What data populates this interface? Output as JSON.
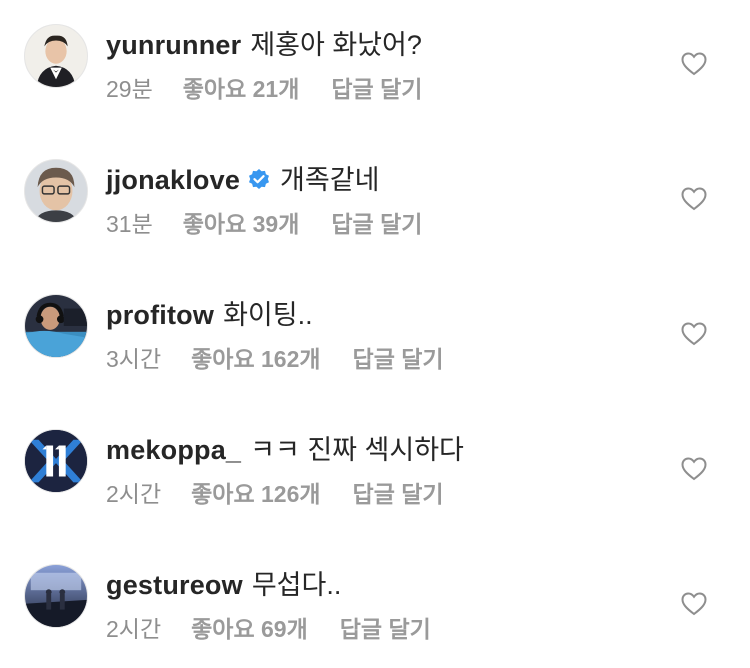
{
  "comments": [
    {
      "username": "yunrunner",
      "verified": false,
      "text": "제홍아 화났어?",
      "time": "29분",
      "likes": "좋아요 21개",
      "reply": "답글 달기",
      "avatar": "avatar-man-suit"
    },
    {
      "username": "jjonaklove",
      "verified": true,
      "text": "개족같네",
      "time": "31분",
      "likes": "좋아요 39개",
      "reply": "답글 달기",
      "avatar": "avatar-man-glasses"
    },
    {
      "username": "profitow",
      "verified": false,
      "text": "화이팅..",
      "time": "3시간",
      "likes": "좋아요 162개",
      "reply": "답글 달기",
      "avatar": "avatar-headset-player"
    },
    {
      "username": "mekoppa_",
      "verified": false,
      "text": "ㅋㅋ 진짜 섹시하다",
      "time": "2시간",
      "likes": "좋아요 126개",
      "reply": "답글 달기",
      "avatar": "avatar-number-11-logo"
    },
    {
      "username": "gestureow",
      "verified": false,
      "text": "무섭다..",
      "time": "2시간",
      "likes": "좋아요 69개",
      "reply": "답글 달기",
      "avatar": "avatar-stage"
    }
  ],
  "colors": {
    "text": "#262626",
    "meta": "#8e8e8e",
    "verified_badge": "#3897f0"
  }
}
